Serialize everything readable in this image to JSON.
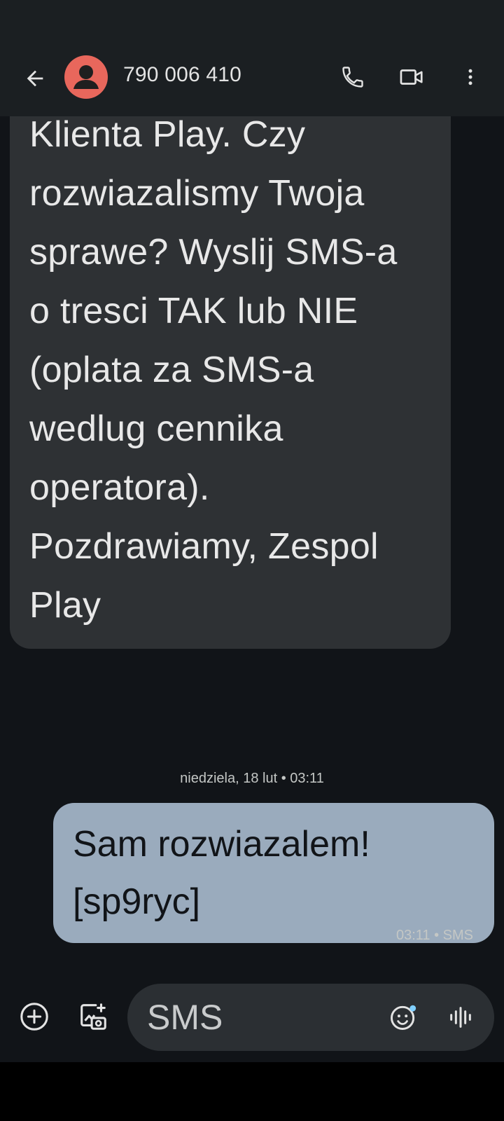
{
  "header": {
    "contact_name": "790 006 410",
    "icons": {
      "back": "arrow-back-icon",
      "avatar": "person-avatar-icon",
      "call": "phone-icon",
      "video": "video-camera-icon",
      "more": "more-vert-icon"
    },
    "avatar_color": "#e8675c"
  },
  "conversation": {
    "incoming_message": {
      "text": "kontakt z Obsluga\nKlienta Play. Czy\nrozwiazalismy Twoja\nsprawe? Wyslij SMS-a\no tresci TAK lub NIE\n(oplata za SMS-a\nwedlug cennika\noperatora).\nPozdrawiamy, Zespol\nPlay"
    },
    "date_divider": "niedziela, 18 lut • 03:11",
    "outgoing_message": {
      "text": "Sam rozwiazalem!\n[sp9ryc]",
      "meta": "03:11 • SMS"
    }
  },
  "compose": {
    "placeholder": "SMS",
    "icons": {
      "add": "add-circle-icon",
      "gallery": "add-photo-icon",
      "emoji": "emoji-icon",
      "voice": "voice-waveform-icon"
    }
  },
  "colors": {
    "background": "#111418",
    "app_bar": "#1b1f22",
    "incoming_bubble": "#2e3134",
    "outgoing_bubble": "#9aabbd",
    "accent_dot": "#7fcfff"
  }
}
